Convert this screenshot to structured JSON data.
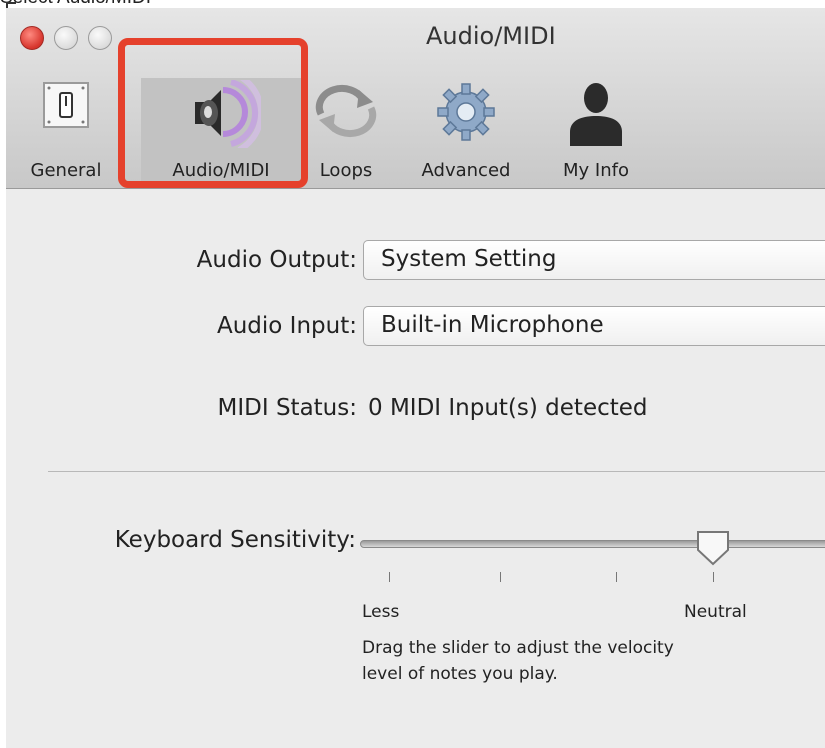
{
  "caption": "Select Audio/MIDI",
  "window": {
    "title": "Audio/MIDI"
  },
  "toolbar": [
    {
      "label": "General",
      "icon": "toggle-switch-icon"
    },
    {
      "label": "Audio/MIDI",
      "icon": "speaker-icon",
      "selected": true
    },
    {
      "label": "Loops",
      "icon": "loop-arrows-icon"
    },
    {
      "label": "Advanced",
      "icon": "gear-icon"
    },
    {
      "label": "My Info",
      "icon": "user-silhouette-icon"
    }
  ],
  "settings": {
    "audio_output": {
      "label": "Audio Output:",
      "value": "System Setting"
    },
    "audio_input": {
      "label": "Audio Input:",
      "value": "Built-in Microphone"
    },
    "midi_status": {
      "label": "MIDI Status:",
      "value": "0 MIDI Input(s) detected"
    }
  },
  "keyboard_sensitivity": {
    "label": "Keyboard Sensitivity:",
    "min_label": "Less",
    "mid_label": "Neutral",
    "help_line1": "Drag the slider to adjust the velocity",
    "help_line2": "level of notes you play."
  },
  "colors": {
    "highlight": "#e5412c",
    "close_button": "#d6342c",
    "accent_purple": "#b27be0"
  }
}
